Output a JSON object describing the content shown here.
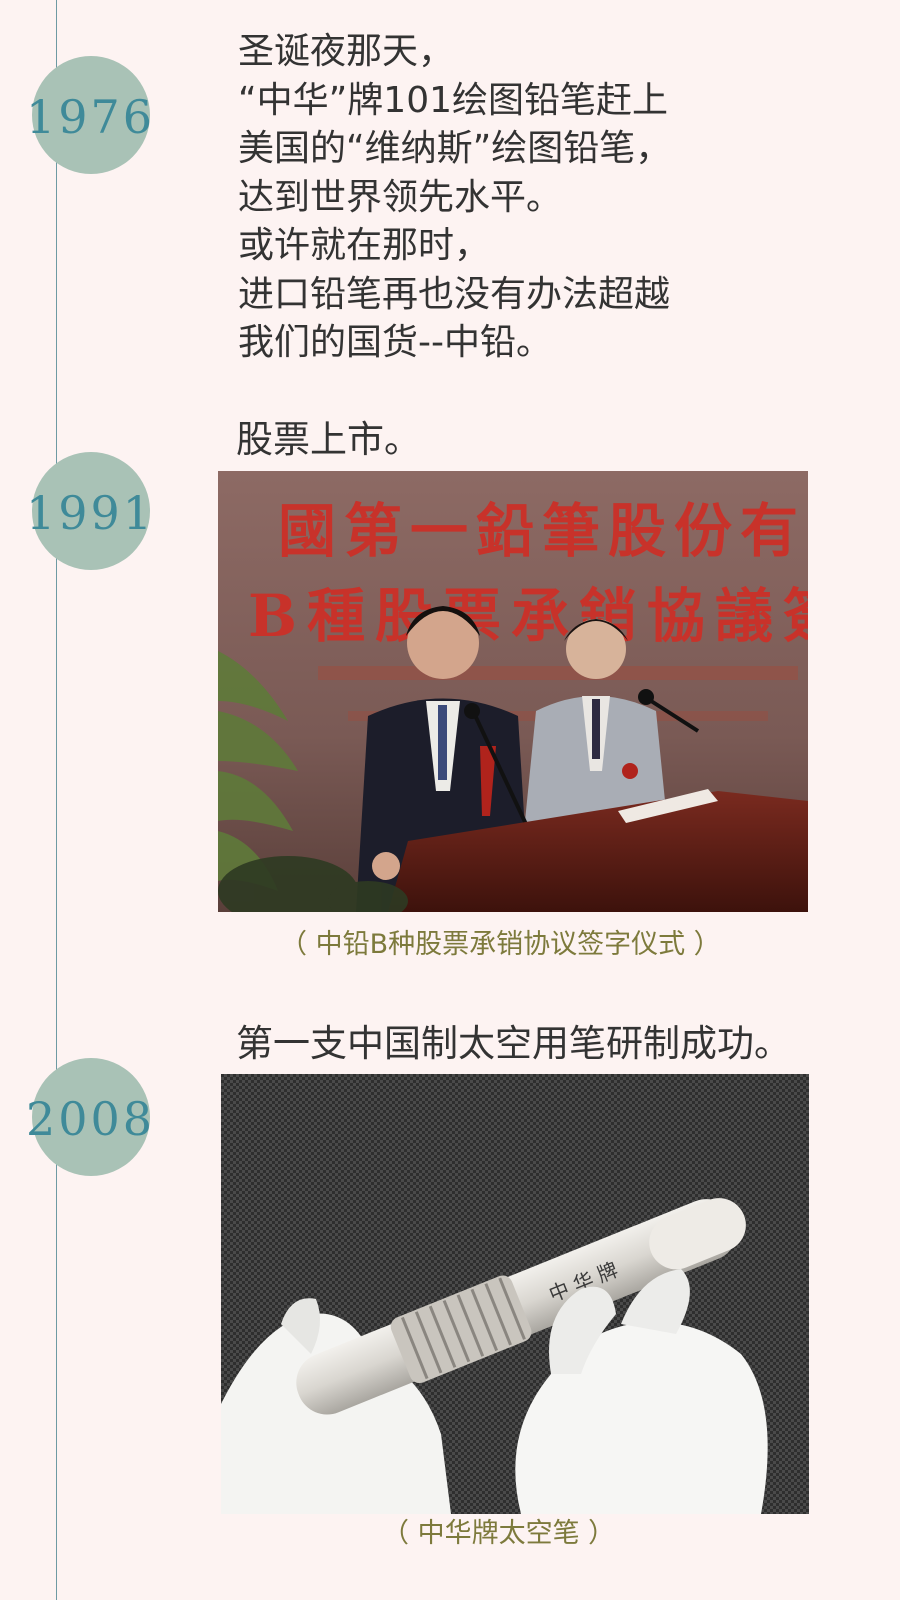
{
  "colors": {
    "background": "#fdf3f2",
    "timeline": "#6e9aa3",
    "badge": "#a9c2b6",
    "year_text": "#3f8a99",
    "body_text": "#333333",
    "caption_text": "#7d7a3c"
  },
  "entries": [
    {
      "year": "1976",
      "text": "圣诞夜那天，\n“中华”牌101绘图铅笔赶上\n美国的“维纳斯”绘图铅笔，\n达到世界领先水平。\n或许就在那时，\n进口铅笔再也没有办法超越\n我们的国货--中铅。"
    },
    {
      "year": "1991",
      "heading": "股票上市。",
      "photo_banner": {
        "line1": "國第一鉛筆股份有限",
        "line2": "B種股票承銷協議簽字"
      },
      "caption": "（ 中铅B种股票承销协议签字仪式 ）"
    },
    {
      "year": "2008",
      "heading": "第一支中国制太空用笔研制成功。",
      "photo_pen_label": "中华牌",
      "caption": "（ 中华牌太空笔 ）"
    }
  ]
}
